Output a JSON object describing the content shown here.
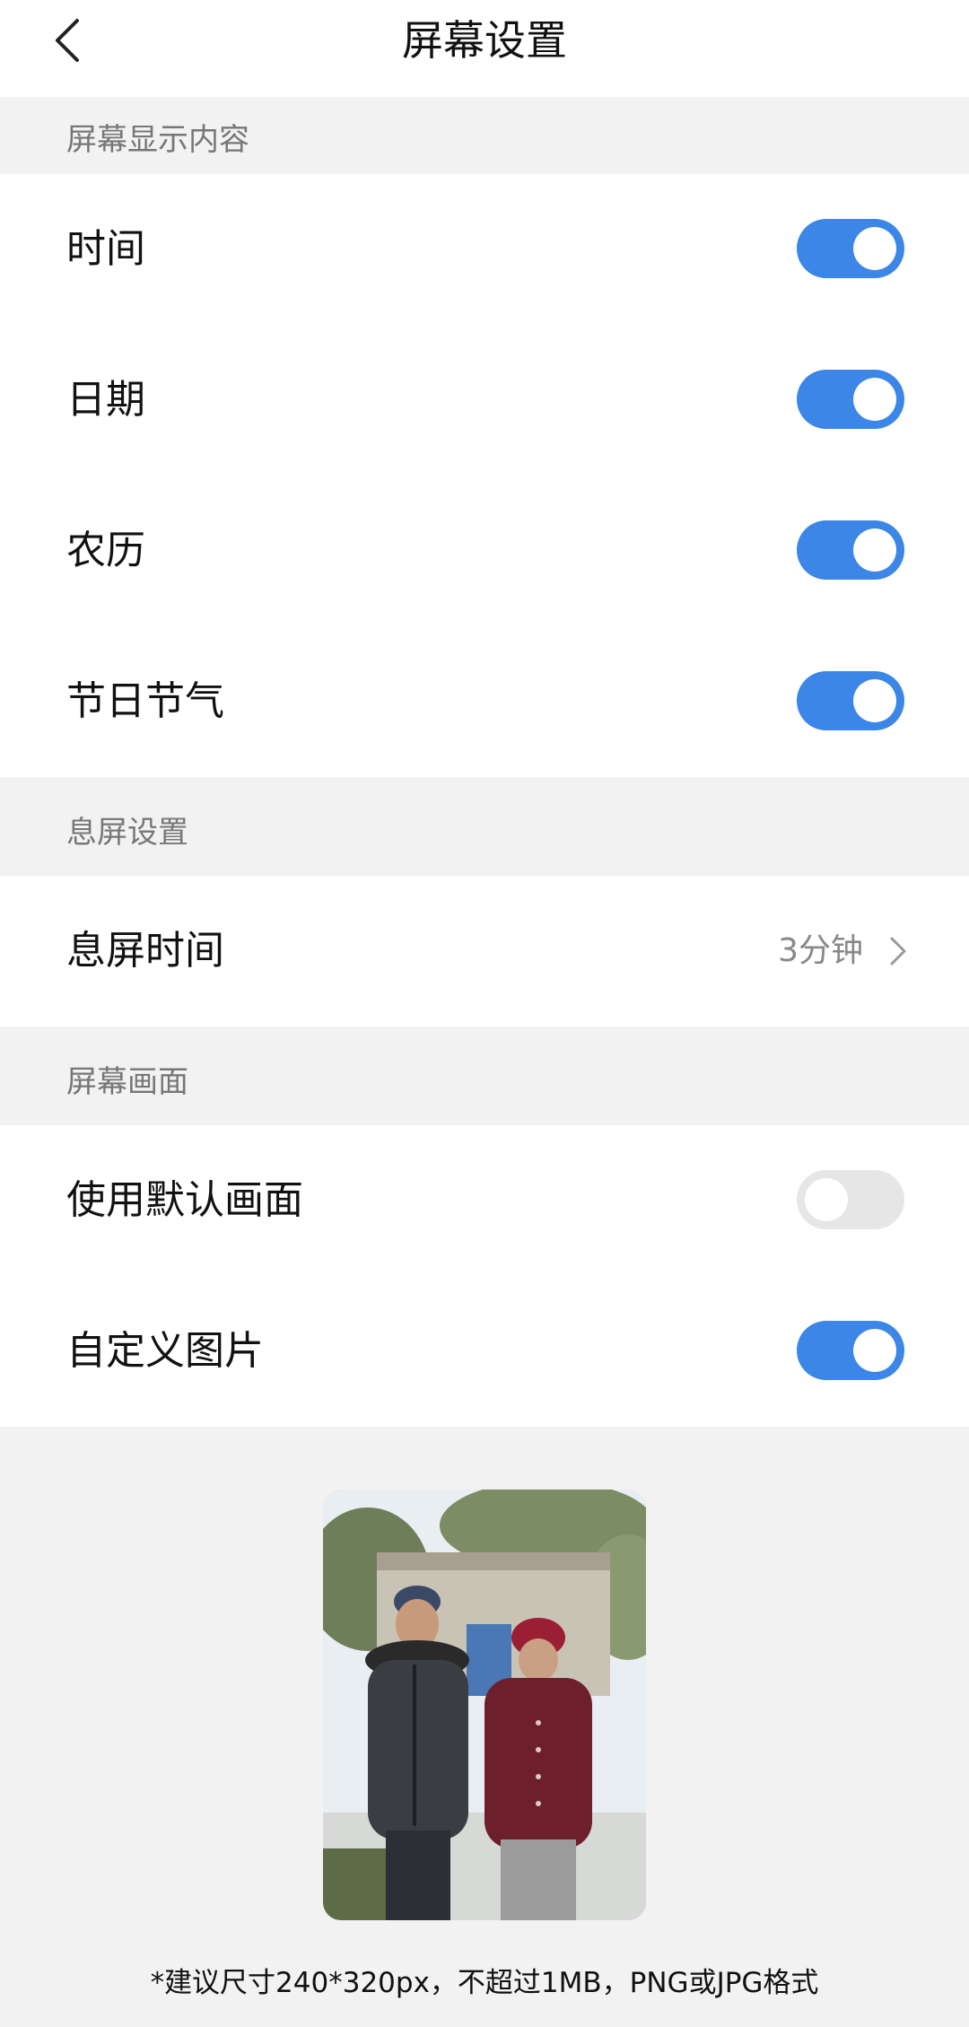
{
  "header": {
    "title": "屏幕设置",
    "back_icon": "chevron-left-icon"
  },
  "sections": {
    "display_content": {
      "title": "屏幕显示内容",
      "items": [
        {
          "label": "时间",
          "toggle": "on"
        },
        {
          "label": "日期",
          "toggle": "on"
        },
        {
          "label": "农历",
          "toggle": "on"
        },
        {
          "label": "节日节气",
          "toggle": "on"
        }
      ]
    },
    "screen_off": {
      "title": "息屏设置",
      "items": [
        {
          "label": "息屏时间",
          "value": "3分钟"
        }
      ]
    },
    "screen_picture": {
      "title": "屏幕画面",
      "items": [
        {
          "label": "使用默认画面",
          "toggle": "off"
        },
        {
          "label": "自定义图片",
          "toggle": "on"
        }
      ]
    }
  },
  "footnote": "*建议尺寸240*320px，不超过1MB，PNG或JPG格式",
  "colors": {
    "toggle_on": "#3b86e6",
    "toggle_off": "#e6e6e6",
    "background": "#f2f2f2"
  }
}
